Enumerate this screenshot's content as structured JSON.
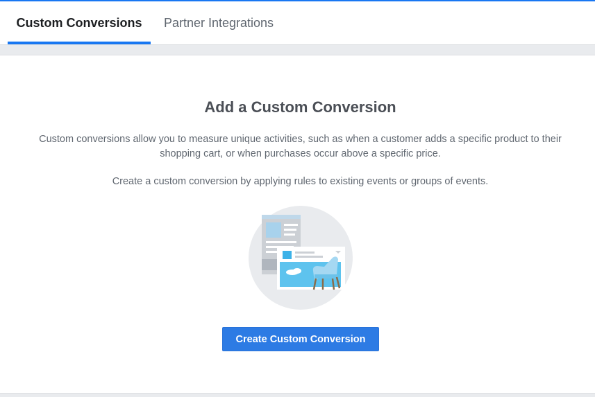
{
  "tabs": {
    "custom_conversions": "Custom Conversions",
    "partner_integrations": "Partner Integrations"
  },
  "main": {
    "title": "Add a Custom Conversion",
    "description": "Custom conversions allow you to measure unique activities, such as when a customer adds a specific product to their shopping cart, or when purchases occur above a specific price.",
    "instruction": "Create a custom conversion by applying rules to existing events or groups of events.",
    "create_button": "Create Custom Conversion"
  },
  "colors": {
    "accent": "#1877f2",
    "button": "#2d7be4",
    "background_gray": "#e9ebee",
    "heading_text": "#4b4f56",
    "body_text": "#606770"
  },
  "icons": {
    "illustration": "custom-conversion-illustration"
  }
}
